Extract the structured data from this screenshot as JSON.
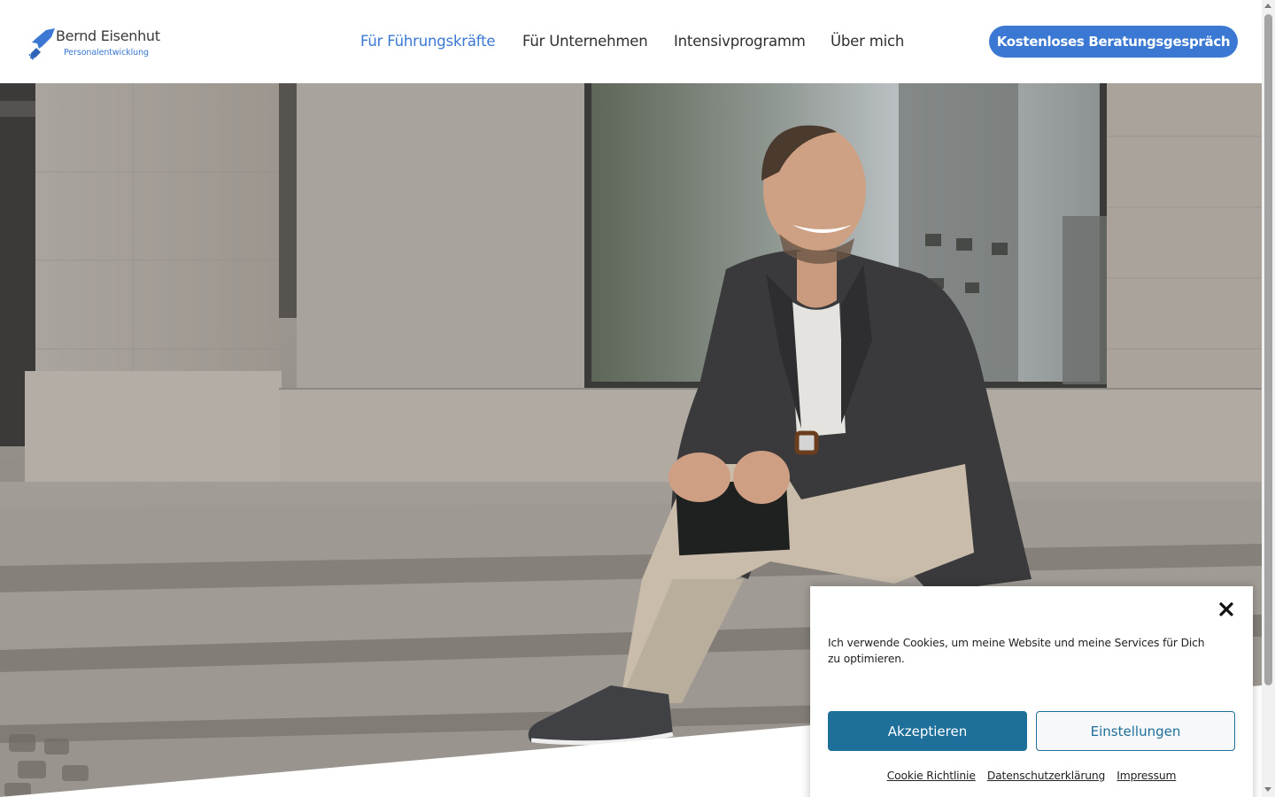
{
  "header": {
    "logo": {
      "name": "Bernd Eisenhut",
      "subtitle": "Personalentwicklung"
    },
    "nav": [
      {
        "label": "Für Führungskräfte",
        "active": true
      },
      {
        "label": "Für Unternehmen",
        "active": false
      },
      {
        "label": "Intensivprogramm",
        "active": false
      },
      {
        "label": "Über mich",
        "active": false
      }
    ],
    "cta_label": "Kostenloses Beratungsgespräch"
  },
  "colors": {
    "brand_blue": "#3a78d4",
    "cookie_button": "#1e6f99"
  },
  "cookie_banner": {
    "text": "Ich verwende Cookies, um meine Website und meine Services für Dich zu optimieren.",
    "accept_label": "Akzeptieren",
    "settings_label": "Einstellungen",
    "links": [
      "Cookie Richtlinie",
      "Datenschutzerklärung",
      "Impressum"
    ]
  }
}
